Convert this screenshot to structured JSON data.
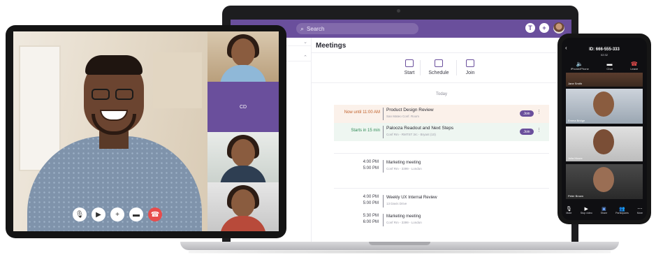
{
  "laptop": {
    "topbar": {
      "nav_arrows": "‹ ›",
      "search_placeholder": "Search",
      "icon_pin": "T",
      "icon_add": "+"
    },
    "meetings": {
      "title": "Meetings",
      "actions": [
        {
          "label": "Start",
          "icon": "video-start-icon"
        },
        {
          "label": "Schedule",
          "icon": "calendar-icon"
        },
        {
          "label": "Join",
          "icon": "join-icon"
        }
      ],
      "section": "Today",
      "live": [
        {
          "when": "Now until 11:00 AM",
          "title": "Product Design Review",
          "sub": "San Mateo Conf. Room",
          "join": "Join"
        },
        {
          "when": "Starts in 15 min",
          "title": "Palooza Readout and Next Steps",
          "sub": "Conf Rm - RMTST 3rc - Bryant (10)",
          "join": "Join"
        }
      ],
      "scheduled": [
        {
          "start": "4:00 PM",
          "end": "5:00 PM",
          "title": "Marketing meeting",
          "sub": "Conf Rm - 3399 - London"
        },
        {
          "start": "4:00 PM",
          "end": "5:00 PM",
          "title": "Weekly UX Internal Review",
          "sub": "13 Davis Drive"
        },
        {
          "start": "5:30 PM",
          "end": "6:00 PM",
          "title": "Marketing meeting",
          "sub": "Conf Rm - 3399 - London"
        }
      ]
    }
  },
  "tablet": {
    "participant_initials": "CD",
    "controls": [
      "microphone-icon",
      "video-camera-icon",
      "add-icon",
      "chat-icon",
      "end-call-icon"
    ]
  },
  "phone": {
    "meeting_id": "ID: 666-555-333",
    "time": "02:32",
    "top_actions": [
      {
        "label": "iPhone/iPhone",
        "icon": "speaker-icon"
      },
      {
        "label": "Chat",
        "icon": "chat-icon"
      },
      {
        "label": "Leave",
        "icon": "leave-icon"
      }
    ],
    "participants": [
      "Jane Smith",
      "Emma Bridge",
      "Julia Moore",
      "Peter Brown"
    ],
    "bottom_bar": [
      {
        "label": "Mute",
        "icon": "microphone-icon"
      },
      {
        "label": "Stop video",
        "icon": "video-camera-icon"
      },
      {
        "label": "Share",
        "icon": "share-icon"
      },
      {
        "label": "Participants",
        "icon": "participants-icon"
      },
      {
        "label": "More",
        "icon": "more-icon"
      }
    ]
  },
  "colors": {
    "brand": "#6a4f9c",
    "end_call": "#e74c4c",
    "now": "#c0602a",
    "starts": "#2f8a55"
  }
}
